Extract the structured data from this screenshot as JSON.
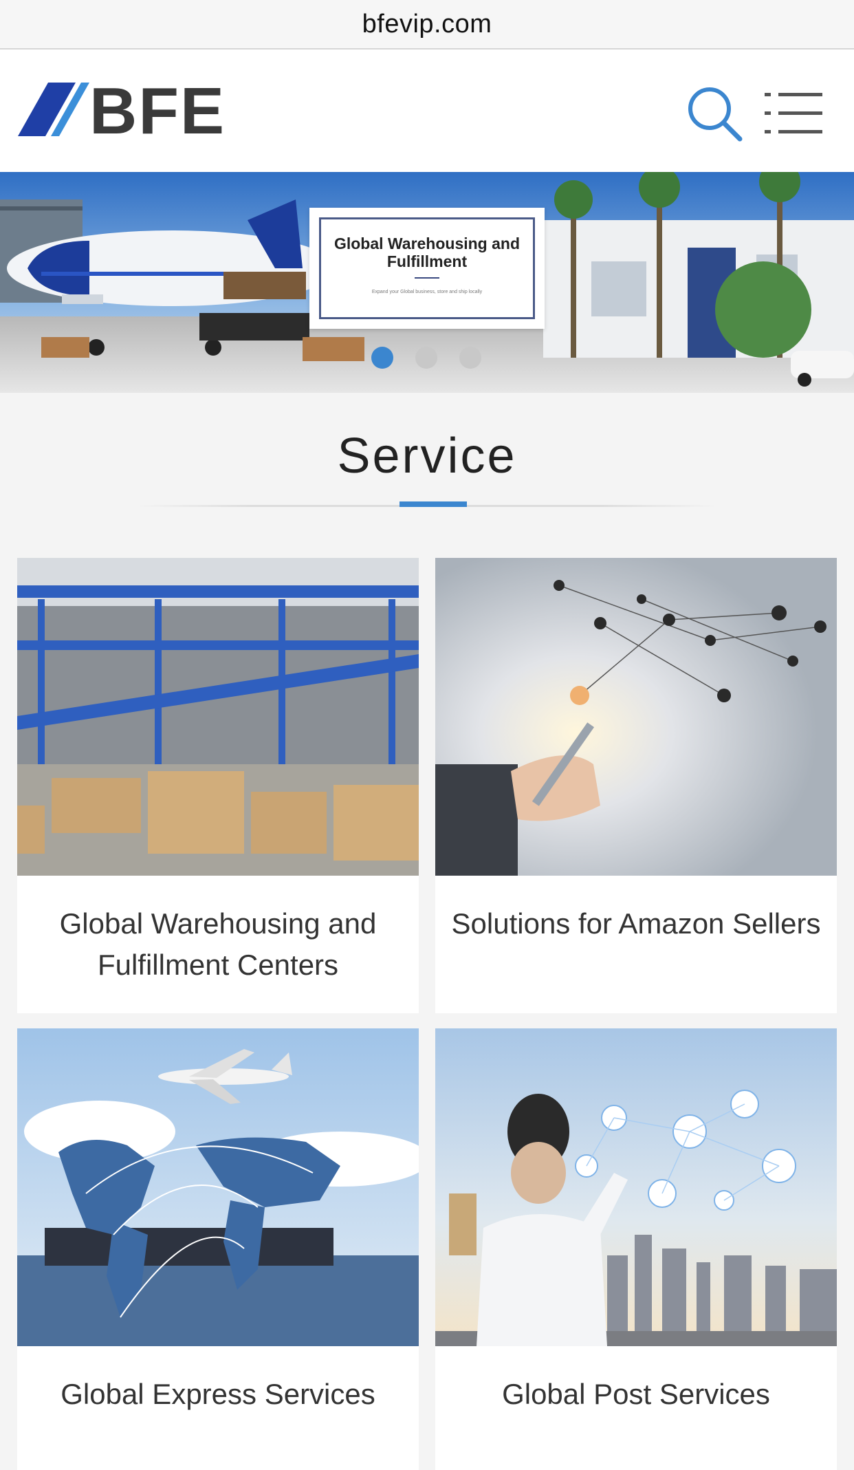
{
  "browser": {
    "url": "bfevip.com"
  },
  "header": {
    "logo_text": "BFE",
    "search_icon": "search-icon",
    "menu_icon": "menu-icon"
  },
  "hero": {
    "title": "Global Warehousing and Fulfillment",
    "subtitle": "Expand your Global business, store and ship locally",
    "slides_count": 3,
    "active_slide": 1,
    "dot_active_color": "#3b86cf",
    "dot_inactive_color": "#c8c8c8"
  },
  "section": {
    "title": "Service",
    "accent_color": "#3b86cf"
  },
  "services": [
    {
      "label": "Global Warehousing and Fulfillment Centers"
    },
    {
      "label": "Solutions for Amazon Sellers"
    },
    {
      "label": "Global Express Services"
    },
    {
      "label": "Global Post Services"
    }
  ],
  "colors": {
    "brand_blue": "#1f3fa6",
    "brand_light_blue": "#3b86cf",
    "logo_dark": "#3a3a3a"
  }
}
